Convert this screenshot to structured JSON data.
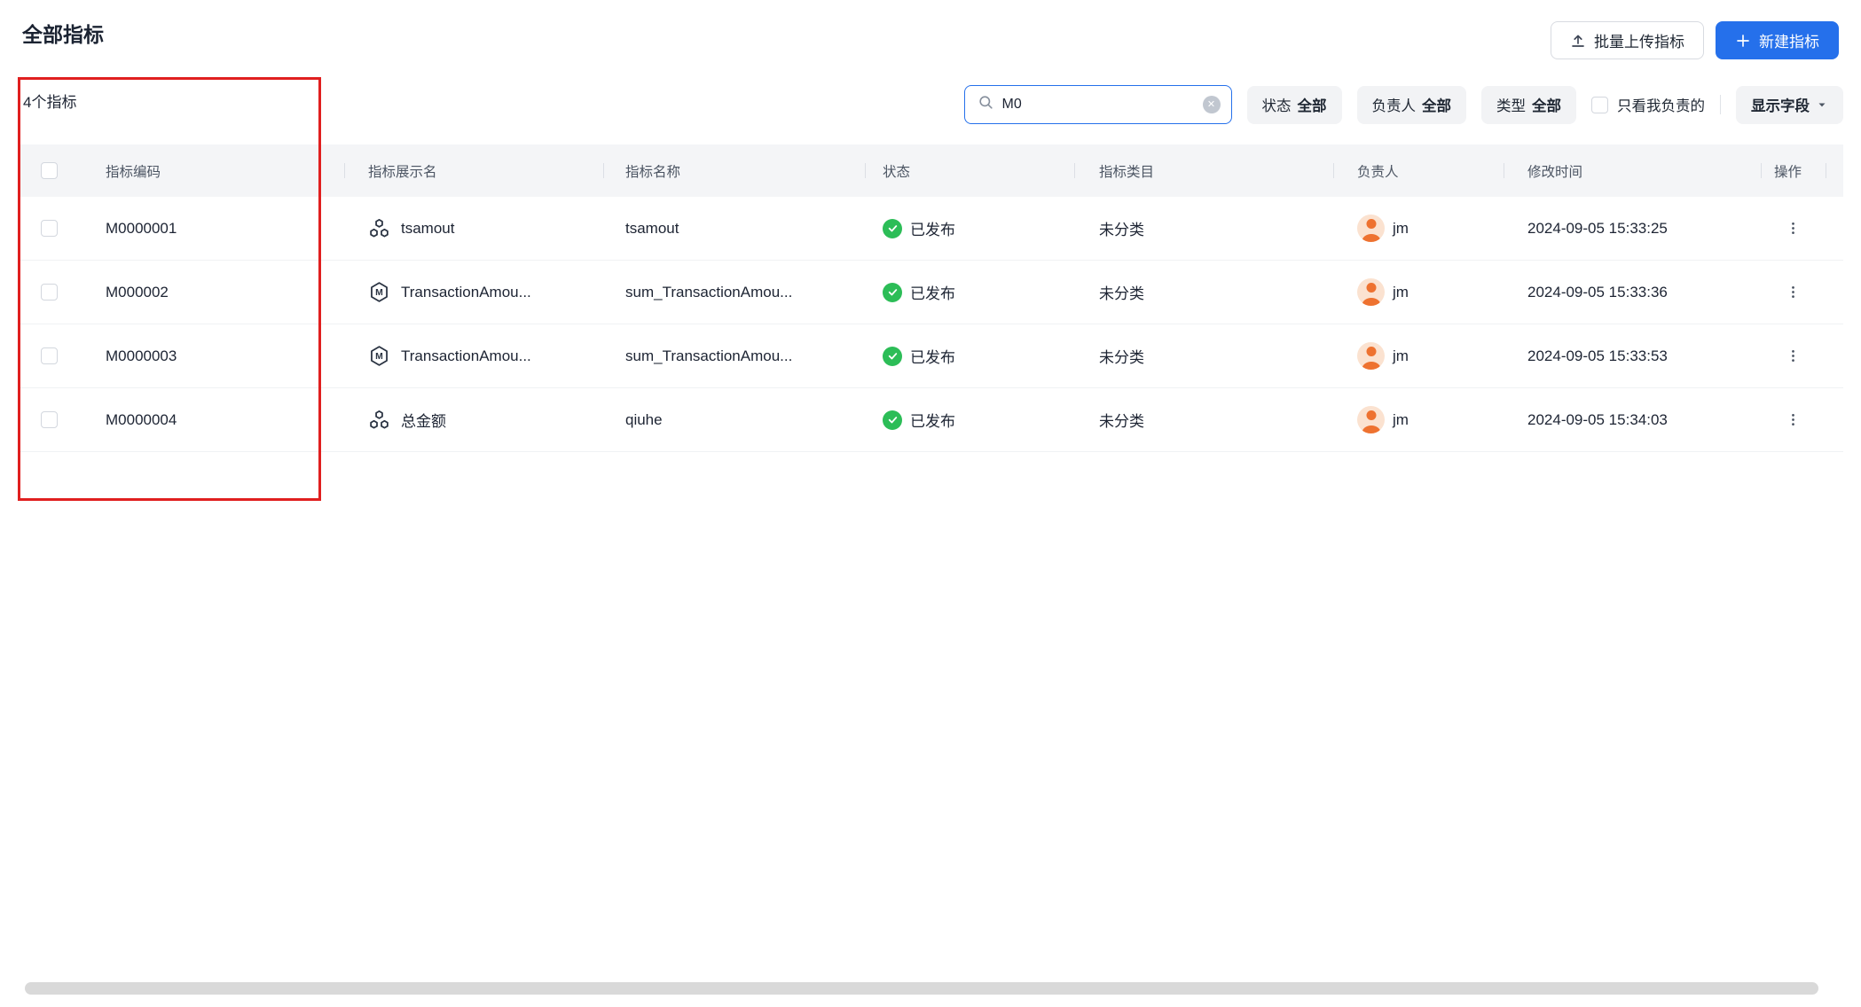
{
  "page": {
    "title": "全部指标",
    "count_label": "4个指标"
  },
  "toolbar": {
    "upload_label": "批量上传指标",
    "create_label": "新建指标"
  },
  "filters": {
    "search_value": "M0",
    "status_label": "状态",
    "status_value": "全部",
    "owner_label": "负责人",
    "owner_value": "全部",
    "type_label": "类型",
    "type_value": "全部",
    "only_mine_label": "只看我负责的",
    "display_fields_label": "显示字段"
  },
  "table": {
    "headers": {
      "code": "指标编码",
      "display_name": "指标展示名",
      "name": "指标名称",
      "status": "状态",
      "category": "指标类目",
      "owner": "负责人",
      "modified": "修改时间",
      "actions": "操作"
    },
    "rows": [
      {
        "code": "M0000001",
        "icon": "cluster",
        "display_name": "tsamout",
        "name": "tsamout",
        "status": "已发布",
        "category": "未分类",
        "owner": "jm",
        "modified": "2024-09-05 15:33:25"
      },
      {
        "code": "M000002",
        "icon": "m-hex",
        "display_name": "TransactionAmou...",
        "name": "sum_TransactionAmou...",
        "status": "已发布",
        "category": "未分类",
        "owner": "jm",
        "modified": "2024-09-05 15:33:36"
      },
      {
        "code": "M0000003",
        "icon": "m-hex",
        "display_name": "TransactionAmou...",
        "name": "sum_TransactionAmou...",
        "status": "已发布",
        "category": "未分类",
        "owner": "jm",
        "modified": "2024-09-05 15:33:53"
      },
      {
        "code": "M0000004",
        "icon": "cluster",
        "display_name": "总金额",
        "name": "qiuhe",
        "status": "已发布",
        "category": "未分类",
        "owner": "jm",
        "modified": "2024-09-05 15:34:03"
      }
    ]
  },
  "colors": {
    "accent_blue": "#2570eb",
    "status_green": "#2cbd57",
    "annotation_red": "#e01f1f",
    "avatar_bg": "#fbe2d0",
    "avatar_fg": "#ee7230"
  }
}
